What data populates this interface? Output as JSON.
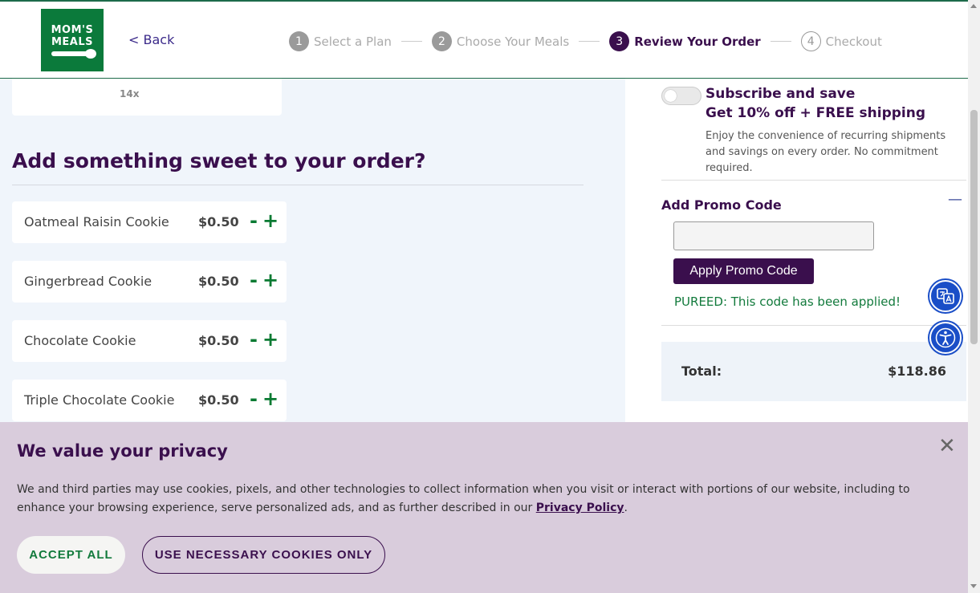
{
  "header": {
    "logo_line1": "MOM'S",
    "logo_line2": "MEALS",
    "back_label": "< Back",
    "steps": [
      {
        "num": "1",
        "label": "Select a Plan"
      },
      {
        "num": "2",
        "label": "Choose Your Meals"
      },
      {
        "num": "3",
        "label": "Review Your Order"
      },
      {
        "num": "4",
        "label": "Checkout"
      }
    ]
  },
  "order": {
    "prev_item_qty": "14x",
    "sweets_title": "Add something sweet to your order?",
    "cookies": [
      {
        "name": "Oatmeal Raisin Cookie",
        "price": "$0.50"
      },
      {
        "name": "Gingerbread Cookie",
        "price": "$0.50"
      },
      {
        "name": "Chocolate Cookie",
        "price": "$0.50"
      },
      {
        "name": "Triple Chocolate Cookie",
        "price": "$0.50"
      }
    ],
    "minus_symbol": "-",
    "plus_symbol": "+"
  },
  "summary": {
    "subscribe_title": "Subscribe and save",
    "subscribe_offer": "Get 10% off + FREE shipping",
    "subscribe_desc": "Enjoy the convenience of recurring shipments and savings on every order. No commitment required.",
    "promo_label": "Add Promo Code",
    "promo_collapse": "—",
    "promo_value": "",
    "promo_button": "Apply Promo Code",
    "promo_message": "PUREED: This code has been applied!",
    "total_label": "Total:",
    "total_value": "$118.86"
  },
  "cookie_banner": {
    "title": "We value your privacy",
    "text_before": "We and third parties may use cookies, pixels, and other technologies to collect information when you visit or interact with portions of our website, including to enhance your browsing experience, serve personalized ads, and as further described in our ",
    "link": "Privacy Policy",
    "text_after": ".",
    "accept": "ACCEPT ALL",
    "necessary": "USE NECESSARY COOKIES ONLY",
    "close": "✕"
  },
  "colors": {
    "brand_green": "#0b7a3b",
    "brand_purple": "#3a0f4d",
    "accessibility_blue": "#1a4ec7"
  }
}
